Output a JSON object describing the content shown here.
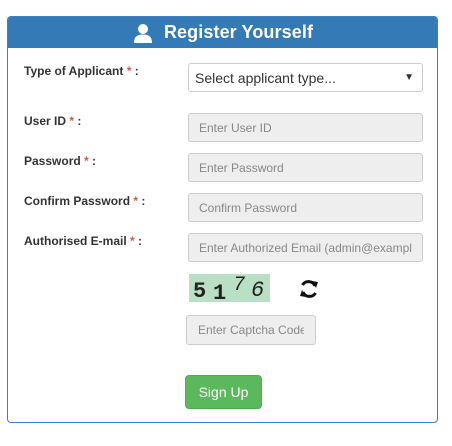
{
  "header": {
    "title": "Register Yourself",
    "icon": "user-icon"
  },
  "form": {
    "applicant_type": {
      "label": "Type of Applicant",
      "required_mark": "*",
      "colon": " :",
      "selected": "Select applicant type..."
    },
    "user_id": {
      "label": "User ID",
      "required_mark": "*",
      "colon": " :",
      "placeholder": "Enter User ID"
    },
    "password": {
      "label": "Password",
      "required_mark": "*",
      "colon": " :",
      "placeholder": "Enter Password"
    },
    "confirm_password": {
      "label": "Confirm Password",
      "required_mark": "*",
      "colon": " :",
      "placeholder": "Confirm Password"
    },
    "email": {
      "label": "Authorised E-mail",
      "required_mark": "*",
      "colon": " :",
      "placeholder": "Enter Authorized Email (admin@exampl"
    },
    "captcha": {
      "code": "5176",
      "refresh_icon": "refresh-icon",
      "placeholder": "Enter Captcha Code"
    },
    "submit_label": "Sign Up"
  },
  "colors": {
    "header": "#337ab7",
    "required": "#d9534f",
    "submit": "#5cb85c",
    "captcha_bg": "#b9dfc4"
  }
}
